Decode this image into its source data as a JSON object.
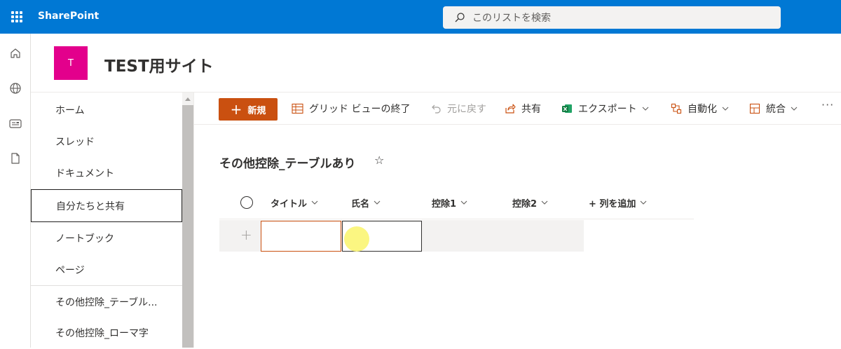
{
  "suite": {
    "app_name": "SharePoint",
    "search_placeholder": "このリストを検索",
    "theme_color": "#0078d4"
  },
  "appbar": {
    "icons": [
      "home-icon",
      "globe-icon",
      "news-icon",
      "document-icon"
    ]
  },
  "site": {
    "logo_letter": "T",
    "logo_color": "#e3008c",
    "title": "TEST用サイト"
  },
  "nav": {
    "items": [
      {
        "label": "ホーム"
      },
      {
        "label": "スレッド"
      },
      {
        "label": "ドキュメント"
      },
      {
        "label": "自分たちと共有",
        "selected": true
      },
      {
        "label": "ノートブック"
      },
      {
        "label": "ページ"
      },
      {
        "label": "その他控除_テーブル..."
      },
      {
        "label": "その他控除_ローマ字"
      }
    ]
  },
  "commandbar": {
    "new_label": "新規",
    "grid_view_exit": "グリッド ビューの終了",
    "undo": "元に戻す",
    "share": "共有",
    "export": "エクスポート",
    "automate": "自動化",
    "integrate": "統合",
    "more": "···",
    "accent_color": "#ca5010"
  },
  "list": {
    "title": "その他控除_テーブルあり",
    "favorite_icon": "☆",
    "columns": [
      "タイトル",
      "氏名",
      "控除1",
      "控除2",
      "+ 列を追加"
    ],
    "add_row_icon": "+"
  }
}
